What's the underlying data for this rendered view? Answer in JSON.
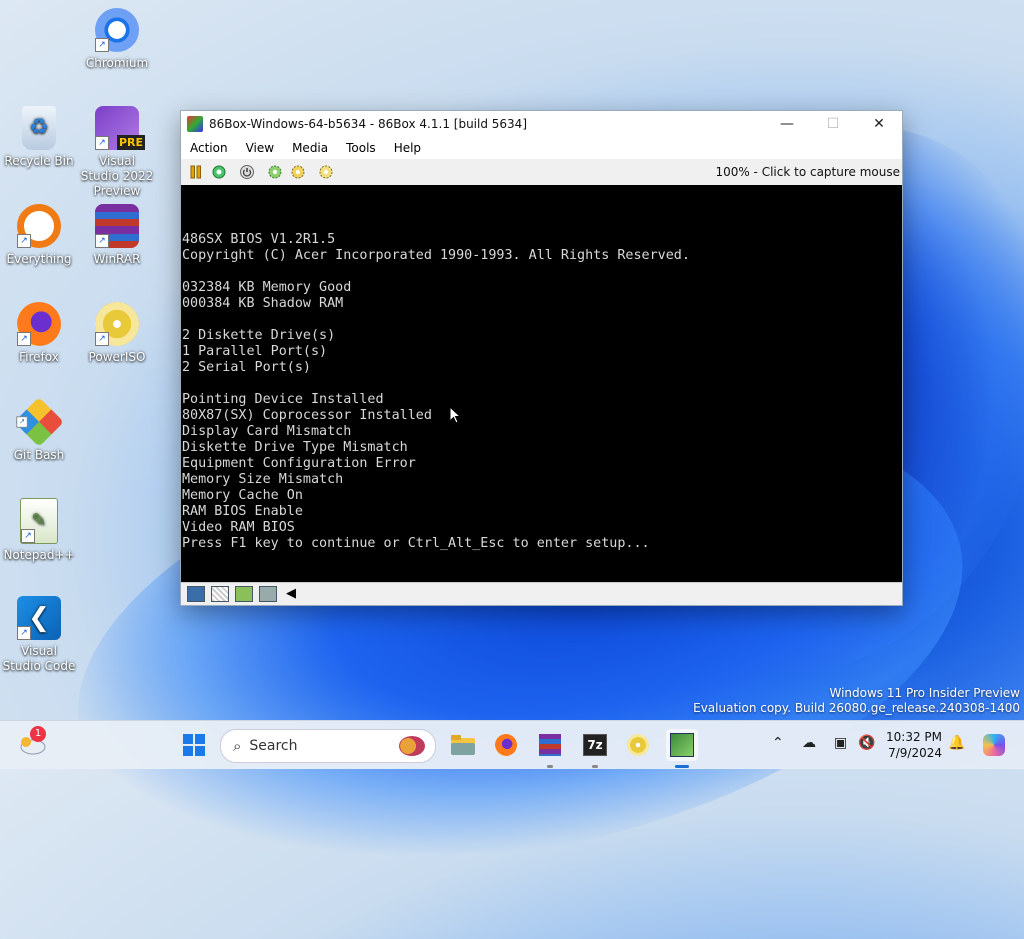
{
  "desktop": {
    "icons": [
      {
        "label": "Chromium",
        "icon": "chromium-icon"
      },
      {
        "label": "Recycle Bin",
        "icon": "recycle-bin-icon"
      },
      {
        "label": "Visual Studio 2022 Preview",
        "icon": "visual-studio-icon",
        "badge": "PRE"
      },
      {
        "label": "Everything",
        "icon": "everything-search-icon"
      },
      {
        "label": "WinRAR",
        "icon": "winrar-icon"
      },
      {
        "label": "Firefox",
        "icon": "firefox-icon"
      },
      {
        "label": "PowerISO",
        "icon": "poweriso-icon"
      },
      {
        "label": "Git Bash",
        "icon": "git-bash-icon"
      },
      {
        "label": "Notepad++",
        "icon": "notepadpp-icon"
      },
      {
        "label": "Visual Studio Code",
        "icon": "vscode-icon"
      }
    ],
    "watermark": {
      "line1": "Windows 11 Pro Insider Preview",
      "line2": "Evaluation copy. Build 26080.ge_release.240308-1400"
    }
  },
  "window": {
    "title": "86Box-Windows-64-b5634 - 86Box 4.1.1 [build 5634]",
    "controls": {
      "minimize": "—",
      "maximize": "☐",
      "close": "✕"
    },
    "menu": [
      "Action",
      "View",
      "Media",
      "Tools",
      "Help"
    ],
    "toolbar_icons": [
      "pause-icon",
      "reset-icon",
      "power-icon",
      "settings-icon",
      "settings-alt-icon",
      "hdd-settings-icon"
    ],
    "status_text": "100% - Click to capture mouse",
    "screen_lines": [
      "486SX BIOS V1.2R1.5",
      "Copyright (C) Acer Incorporated 1990-1993. All Rights Reserved.",
      "",
      "032384 KB Memory Good",
      "000384 KB Shadow RAM",
      "",
      "2 Diskette Drive(s)",
      "1 Parallel Port(s)",
      "2 Serial Port(s)",
      "",
      "Pointing Device Installed",
      "80X87(SX) Coprocessor Installed",
      "Display Card Mismatch",
      "Diskette Drive Type Mismatch",
      "Equipment Configuration Error",
      "Memory Size Mismatch",
      "Memory Cache On",
      "RAM BIOS Enable",
      "Video RAM BIOS",
      "Press F1 key to continue or Ctrl_Alt_Esc to enter setup..."
    ],
    "statusbar_icons": [
      "floppy-icon",
      "cdrom-icon",
      "network-icon",
      "hdd-icon",
      "sound-icon"
    ]
  },
  "taskbar": {
    "search_placeholder": "Search",
    "widgets_badge": "1",
    "clock_time": "10:32 PM",
    "clock_date": "7/9/2024",
    "apps": [
      "start-icon",
      "file-explorer-icon",
      "firefox-icon",
      "winrar-icon",
      "7zip-icon",
      "poweriso-icon",
      "86box-icon"
    ]
  }
}
